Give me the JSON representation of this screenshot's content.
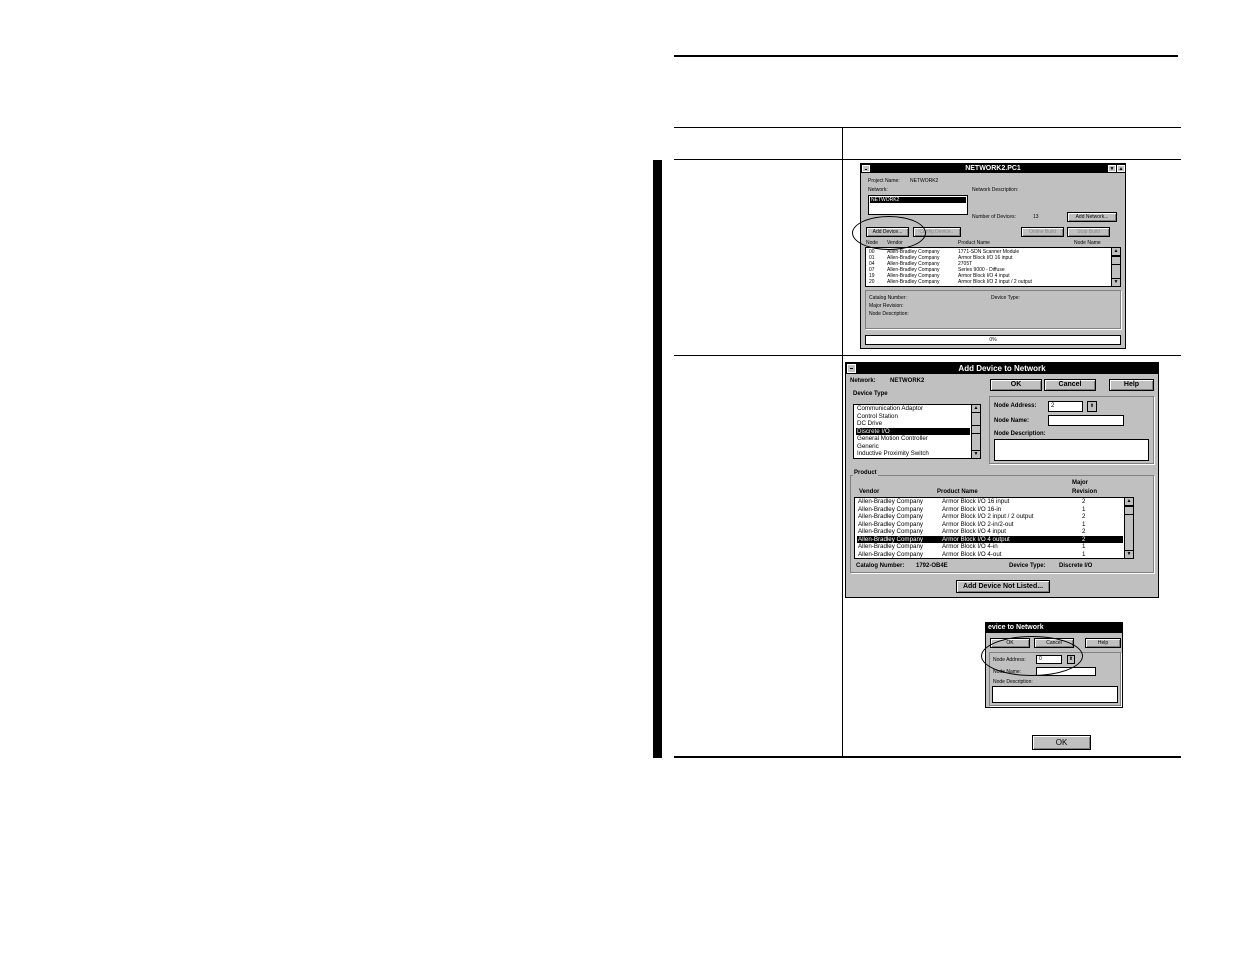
{
  "win1": {
    "title": "NETWORK2.PC1",
    "project_label": "Project Name:",
    "project_value": "NETWORK2",
    "network_label": "Network:",
    "network_value": "NETWORK2",
    "netdesc_label": "Network Description:",
    "devices_label": "Number of Devices:",
    "devices_value": "13",
    "add_network": "Add Network...",
    "add_device": "Add Device...",
    "config_device": "Config Device...",
    "online_build": "Online Build",
    "stop_build": "Stop Build",
    "columns": [
      "Node",
      "Vendor",
      "Product Name",
      "Node Name"
    ],
    "rows": [
      [
        "00",
        "Allen-Bradley Company",
        "1771-SDN Scanner Module"
      ],
      [
        "01",
        "Allen-Bradley Company",
        "Armor Block I/O  16 input"
      ],
      [
        "04",
        "Allen-Bradley Company",
        "2705T"
      ],
      [
        "07",
        "Allen-Bradley Company",
        "Series 9000 - Diffuse"
      ],
      [
        "19",
        "Allen-Bradley Company",
        "Armor Block I/O  4 input"
      ],
      [
        "20",
        "Allen-Bradley Company",
        "Armor Block I/O  2 input / 2 output"
      ]
    ],
    "catalog_label": "Catalog Number:",
    "major_label": "Major Revision:",
    "nodedesc_label": "Node Description:",
    "devtype_label": "Device Type:",
    "progress": "0%"
  },
  "win2": {
    "title": "Add Device to Network",
    "network_label": "Network:",
    "network_value": "NETWORK2",
    "ok": "OK",
    "cancel": "Cancel",
    "help": "Help",
    "device_type_label": "Device Type",
    "device_types": [
      "Communication Adaptor",
      "Control Station",
      "DC Drive",
      "Discrete I/O",
      "General Motion Controller",
      "Generic",
      "Inductive Proximity Switch"
    ],
    "node_address_label": "Node Address:",
    "node_address_value": "2",
    "node_name_label": "Node Name:",
    "node_desc_label": "Node Description:",
    "product_label": "Product",
    "major_label": "Major",
    "col_vendor": "Vendor",
    "col_product": "Product Name",
    "col_revision": "Revision",
    "products": [
      [
        "Allen-Bradley Company",
        "Armor Block I/O  16 input",
        "2"
      ],
      [
        "Allen-Bradley Company",
        "Armor Block I/O  16-in",
        "1"
      ],
      [
        "Allen-Bradley Company",
        "Armor Block I/O  2 input / 2 output",
        "2"
      ],
      [
        "Allen-Bradley Company",
        "Armor Block I/O  2-in/2-out",
        "1"
      ],
      [
        "Allen-Bradley Company",
        "Armor Block I/O  4 input",
        "2"
      ],
      [
        "Allen-Bradley Company",
        "Armor Block I/O  4 output",
        "2"
      ],
      [
        "Allen-Bradley Company",
        "Armor Block I/O  4-in",
        "1"
      ],
      [
        "Allen-Bradley Company",
        "Armor Block I/O  4-out",
        "1"
      ]
    ],
    "catalog_label": "Catalog Number:",
    "catalog_value": "1792-OB4E",
    "devtype_label": "Device Type:",
    "devtype_value": "Discrete I/O",
    "add_not_listed": "Add Device Not Listed..."
  },
  "win3": {
    "title": "evice to Network",
    "ok": "OK",
    "cancel": "Cancel",
    "help": "Help",
    "node_address_label": "Node Address:",
    "node_address_value": "0",
    "node_name_label": "Node Name:",
    "node_desc_label": "Node Description:"
  },
  "ok_button": "OK"
}
